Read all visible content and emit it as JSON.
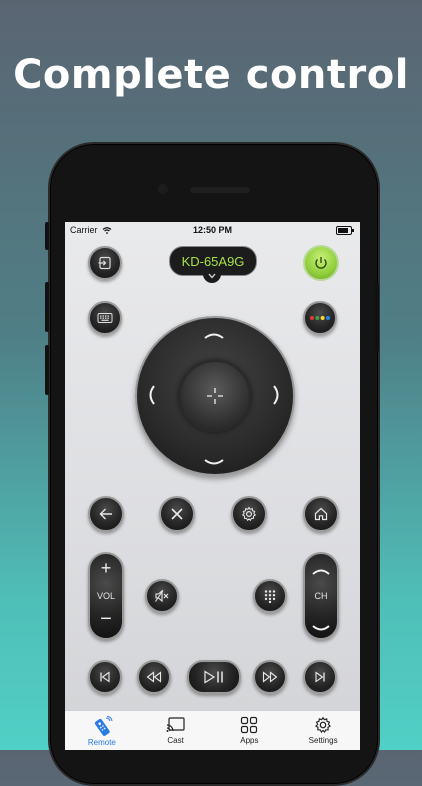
{
  "headline": "Complete control",
  "status": {
    "carrier": "Carrier",
    "time": "12:50 PM"
  },
  "device": {
    "name": "KD-65A9G"
  },
  "volume": {
    "plus": "+",
    "label": "VOL",
    "minus": "−"
  },
  "channel": {
    "label": "CH"
  },
  "tabs": [
    {
      "label": "Remote",
      "icon": "remote-icon",
      "active": true
    },
    {
      "label": "Cast",
      "icon": "cast-icon",
      "active": false
    },
    {
      "label": "Apps",
      "icon": "apps-grid-icon",
      "active": false
    },
    {
      "label": "Settings",
      "icon": "gear-icon",
      "active": false
    }
  ],
  "colors": {
    "power": "#8fd03c",
    "device_text": "#a6e04a",
    "tab_active": "#2a7be4",
    "color_dots": [
      "#e53935",
      "#43a047",
      "#fdd835",
      "#1e88e5"
    ]
  }
}
